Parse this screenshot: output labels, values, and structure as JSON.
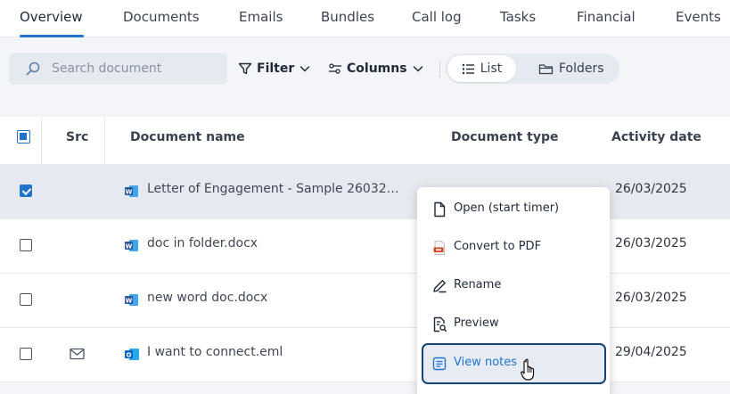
{
  "tabs": [
    {
      "label": "Overview",
      "active": true
    },
    {
      "label": "Documents"
    },
    {
      "label": "Emails"
    },
    {
      "label": "Bundles"
    },
    {
      "label": "Call log"
    },
    {
      "label": "Tasks"
    },
    {
      "label": "Financial"
    },
    {
      "label": "Events"
    }
  ],
  "toolbar": {
    "search_placeholder": "Search document",
    "search_value": "",
    "filter_label": "Filter",
    "columns_label": "Columns",
    "view_list_label": "List",
    "view_folders_label": "Folders",
    "active_view": "List"
  },
  "table": {
    "columns": [
      "Src",
      "Document name",
      "Document type",
      "Activity date"
    ],
    "rows": [
      {
        "selected": true,
        "checked": true,
        "src_icon": "",
        "file_icon": "word-file-icon",
        "name": "Letter of Engagement - Sample 26032…",
        "type": "",
        "date": "26/03/2025"
      },
      {
        "selected": false,
        "checked": false,
        "src_icon": "",
        "file_icon": "word-file-icon",
        "name": "doc in folder.docx",
        "type": "",
        "date": "26/03/2025"
      },
      {
        "selected": false,
        "checked": false,
        "src_icon": "",
        "file_icon": "word-file-icon",
        "name": "new word doc.docx",
        "type": "",
        "date": "26/03/2025"
      },
      {
        "selected": false,
        "checked": false,
        "src_icon": "envelope-icon",
        "file_icon": "outlook-file-icon",
        "name": "I want to connect.eml",
        "type": "",
        "date": "29/04/2025"
      }
    ]
  },
  "context_menu": {
    "items": [
      {
        "label": "Open (start timer)",
        "icon": "document-icon"
      },
      {
        "label": "Convert to PDF",
        "icon": "pdf-icon"
      },
      {
        "label": "Rename",
        "icon": "pencil-icon"
      },
      {
        "label": "Preview",
        "icon": "preview-icon"
      },
      {
        "label": "View notes",
        "icon": "notes-icon",
        "highlighted": true
      }
    ]
  },
  "colors": {
    "accent": "#1f73c9",
    "highlight_border": "#18427a",
    "word_blue": "#2b579a",
    "outlook_blue": "#0a64c4",
    "pdf_red": "#d24726"
  }
}
